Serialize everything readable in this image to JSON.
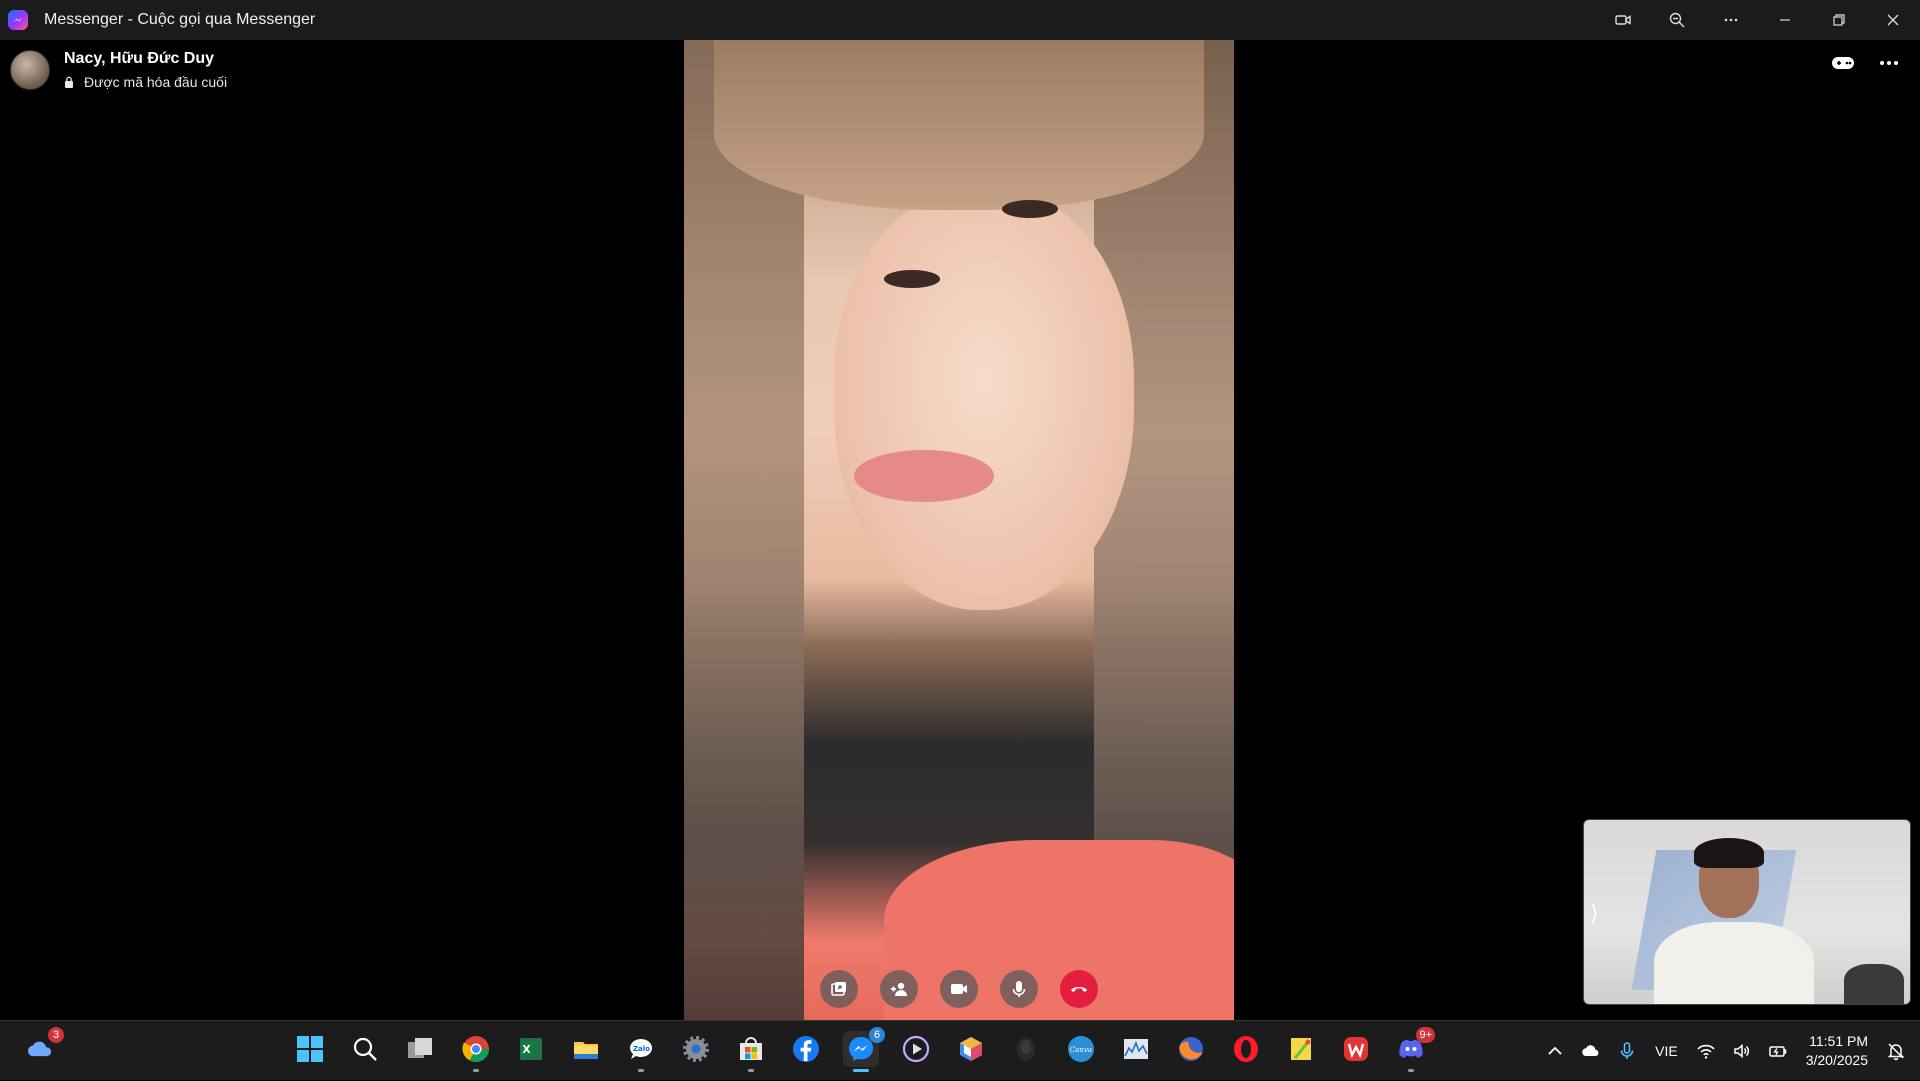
{
  "window": {
    "title": "Messenger - Cuộc gọi qua Messenger"
  },
  "caller": {
    "name": "Nacy, Hữu Đức Duy",
    "status": "Được mã hóa đầu cuối"
  },
  "call_controls": [
    {
      "name": "share-screen",
      "icon": "screen-share-icon"
    },
    {
      "name": "add-person",
      "icon": "add-person-icon"
    },
    {
      "name": "camera",
      "icon": "video-camera-icon"
    },
    {
      "name": "microphone",
      "icon": "microphone-icon"
    },
    {
      "name": "end-call",
      "icon": "phone-hangup-icon",
      "color": "#e41e3f"
    }
  ],
  "taskbar": {
    "weather_badge": "3",
    "messenger_badge": "6",
    "discord_badge": "9+",
    "apps": [
      "windows-start",
      "search",
      "task-view",
      "chrome",
      "excel",
      "file-explorer",
      "zalo",
      "settings",
      "microsoft-store",
      "facebook",
      "messenger",
      "media-player",
      "app-cube",
      "app-dark",
      "canva",
      "resource-monitor",
      "firefox",
      "opera",
      "sticky-app",
      "wps-office",
      "discord"
    ]
  },
  "tray": {
    "language": "VIE",
    "time": "11:51 PM",
    "date": "3/20/2025"
  }
}
